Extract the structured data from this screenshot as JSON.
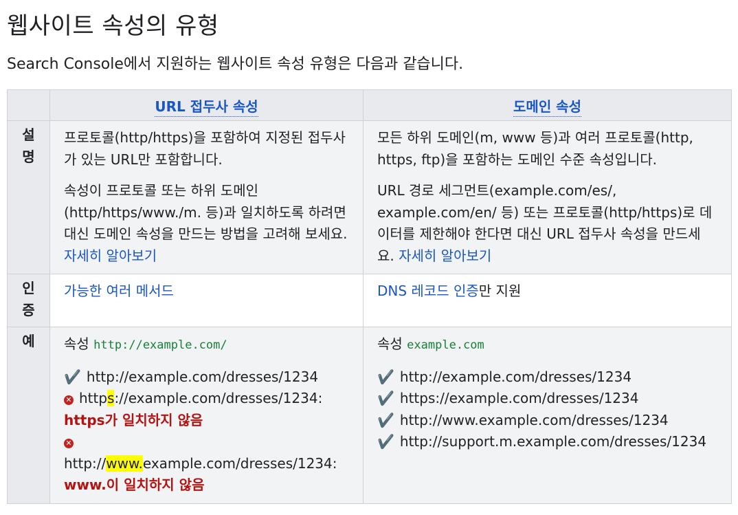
{
  "title": "웹사이트 속성의 유형",
  "intro": "Search Console에서 지원하는 웹사이트 속성 유형은 다음과 같습니다.",
  "table": {
    "headers": [
      "",
      "URL 접두사 속성",
      "도메인 속성"
    ],
    "rows": {
      "description": {
        "label": "설명",
        "url_prefix": {
          "p1": "프로토콜(http/https)을 포함하여 지정된 접두사가 있는 URL만 포함합니다.",
          "p2": "속성이 프로토콜 또는 하위 도메인(http/https/www./m. 등)과 일치하도록 하려면 대신 도메인 속성을 만드는 방법을 고려해 보세요. ",
          "p2_link": "자세히 알아보기"
        },
        "domain": {
          "p1": "모든 하위 도메인(m, www 등)과 여러 프로토콜(http, https, ftp)을 포함하는 도메인 수준 속성입니다.",
          "p2": "URL 경로 세그먼트(example.com/es/, example.com/en/ 등) 또는 프로토콜(http/https)로 데이터를 제한해야 한다면 대신 URL 접두사 속성을 만드세요. ",
          "p2_link": "자세히 알아보기"
        }
      },
      "verification": {
        "label": "인증",
        "url_prefix": {
          "link": "가능한 여러 메서드"
        },
        "domain": {
          "link": "DNS 레코드 인증",
          "suffix": "만 지원"
        }
      },
      "example": {
        "label": "예",
        "url_prefix": {
          "property_label": "속성 ",
          "property_value": "http://example.com/",
          "ok_url": "http://example.com/dresses/1234",
          "bad1_pre": "http",
          "bad1_hl": "s",
          "bad1_post": "://example.com/dresses/1234: ",
          "bad1_reason": "https가 일치하지 않음",
          "bad2_pre": "http://",
          "bad2_hl": "www.",
          "bad2_post": "example.com/dresses/1234: ",
          "bad2_reason": "www.이 일치하지 않음"
        },
        "domain": {
          "property_label": "속성 ",
          "property_value": "example.com",
          "ok_urls": [
            "http://example.com/dresses/1234",
            "https://example.com/dresses/1234",
            "http://www.example.com/dresses/1234",
            "http://support.m.example.com/dresses/1234"
          ]
        }
      }
    }
  },
  "icons": {
    "ok": "check-mark-icon",
    "bad": "cross-mark-icon"
  },
  "colors": {
    "link": "#1a56c6",
    "error": "#b31412",
    "highlight": "#ffff00",
    "code": "#188038"
  }
}
